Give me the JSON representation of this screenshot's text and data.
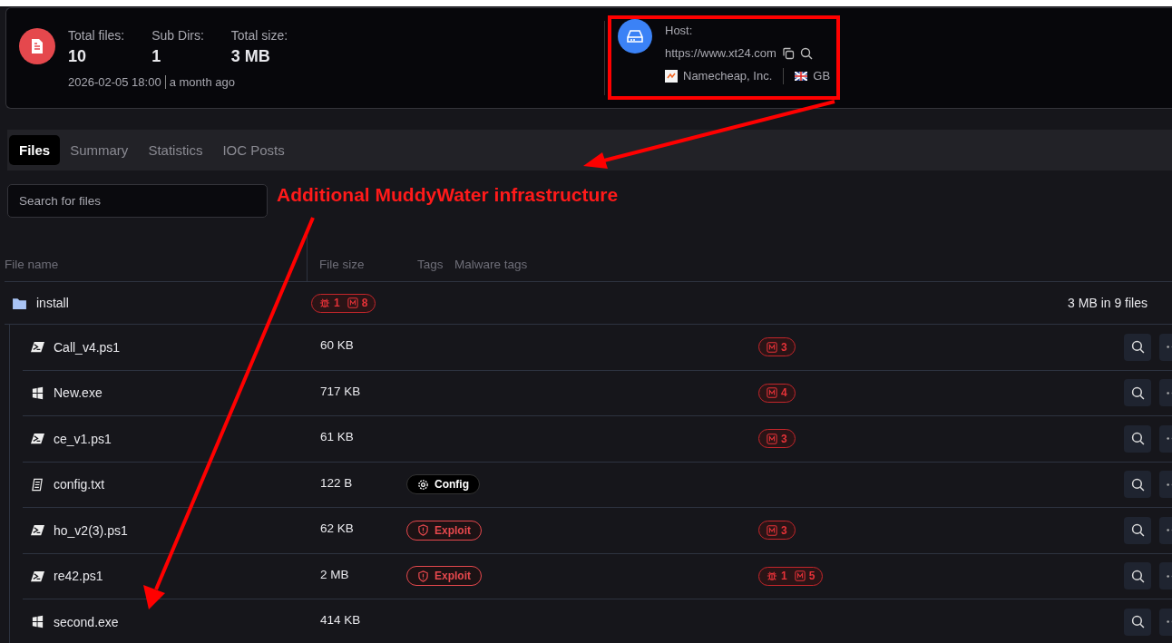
{
  "summary": {
    "stats": [
      {
        "label": "Total files:",
        "value": "10"
      },
      {
        "label": "Sub Dirs:",
        "value": "1"
      },
      {
        "label": "Total size:",
        "value": "3 MB"
      }
    ],
    "date": "2026-02-05 18:00",
    "relative": "a month ago"
  },
  "host": {
    "label": "Host:",
    "url": "https://www.xt24.com",
    "provider": "Namecheap, Inc.",
    "country": "GB"
  },
  "tabs": [
    {
      "label": "Files",
      "selected": true
    },
    {
      "label": "Summary",
      "selected": false
    },
    {
      "label": "Statistics",
      "selected": false
    },
    {
      "label": "IOC Posts",
      "selected": false
    }
  ],
  "search": {
    "placeholder": "Search for files"
  },
  "annotation": {
    "text": "Additional MuddyWater infrastructure"
  },
  "table": {
    "columns": [
      "File name",
      "File size",
      "Tags",
      "Malware tags"
    ],
    "folder": {
      "name": "install",
      "badges": [
        {
          "kind": "bug",
          "count": "1"
        },
        {
          "kind": "malware",
          "count": "8"
        }
      ],
      "summary": "3 MB in 9 files"
    },
    "rows": [
      {
        "name": "Call_v4.ps1",
        "kind": "script",
        "size": "60 KB",
        "badges": [
          {
            "kind": "malware",
            "count": "3"
          }
        ]
      },
      {
        "name": "New.exe",
        "kind": "exe",
        "size": "717 KB",
        "badges": [
          {
            "kind": "malware",
            "count": "4"
          }
        ]
      },
      {
        "name": "ce_v1.ps1",
        "kind": "script",
        "size": "61 KB",
        "badges": [
          {
            "kind": "malware",
            "count": "3"
          }
        ]
      },
      {
        "name": "config.txt",
        "kind": "text",
        "size": "122 B",
        "tag": {
          "kind": "config",
          "label": "Config"
        }
      },
      {
        "name": "ho_v2(3).ps1",
        "kind": "script",
        "size": "62 KB",
        "tag": {
          "kind": "exploit",
          "label": "Exploit"
        },
        "badges": [
          {
            "kind": "malware",
            "count": "3"
          }
        ]
      },
      {
        "name": "re42.ps1",
        "kind": "script",
        "size": "2 MB",
        "tag": {
          "kind": "exploit",
          "label": "Exploit"
        },
        "badges": [
          {
            "kind": "bug",
            "count": "1"
          },
          {
            "kind": "malware",
            "count": "5"
          }
        ]
      },
      {
        "name": "second.exe",
        "kind": "exe",
        "size": "414 KB"
      }
    ]
  }
}
